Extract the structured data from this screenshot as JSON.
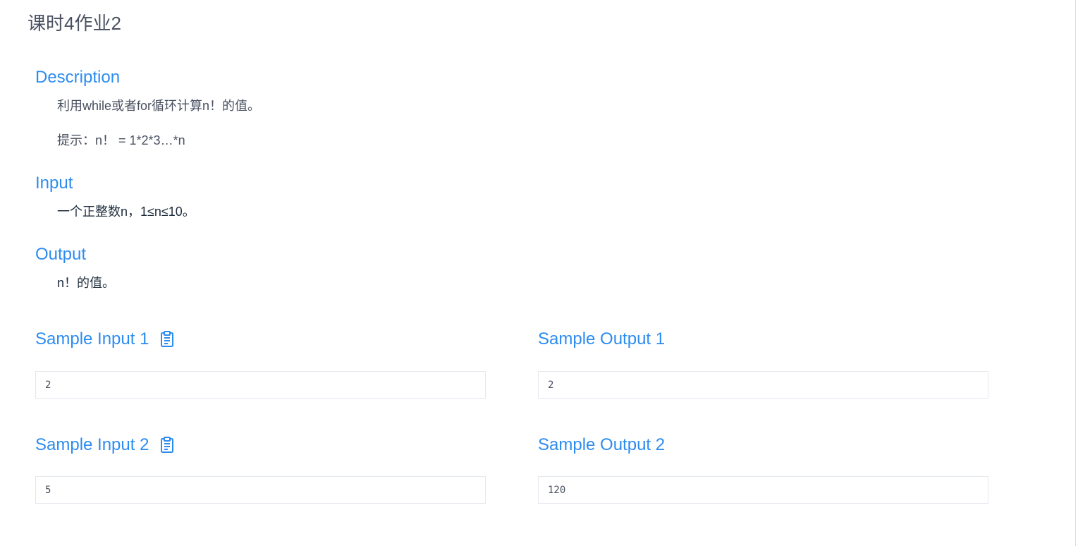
{
  "problem": {
    "title": "课时4作业2"
  },
  "description": {
    "heading": "Description",
    "lines": [
      "利用while或者for循环计算n！的值。",
      "提示：n！ = 1*2*3…*n"
    ]
  },
  "input": {
    "heading": "Input",
    "text": "一个正整数n，1≤n≤10。"
  },
  "output": {
    "heading": "Output",
    "text": "n！的值。"
  },
  "samples": [
    {
      "input_label": "Sample Input 1",
      "output_label": "Sample Output 1",
      "input_value": "2",
      "output_value": "2",
      "copy_icon": "clipboard-icon"
    },
    {
      "input_label": "Sample Input 2",
      "output_label": "Sample Output 2",
      "input_value": "5",
      "output_value": "120",
      "copy_icon": "clipboard-icon"
    }
  ],
  "colors": {
    "accent": "#2d8cf0",
    "text": "#495060",
    "border": "#e3e8ee"
  }
}
